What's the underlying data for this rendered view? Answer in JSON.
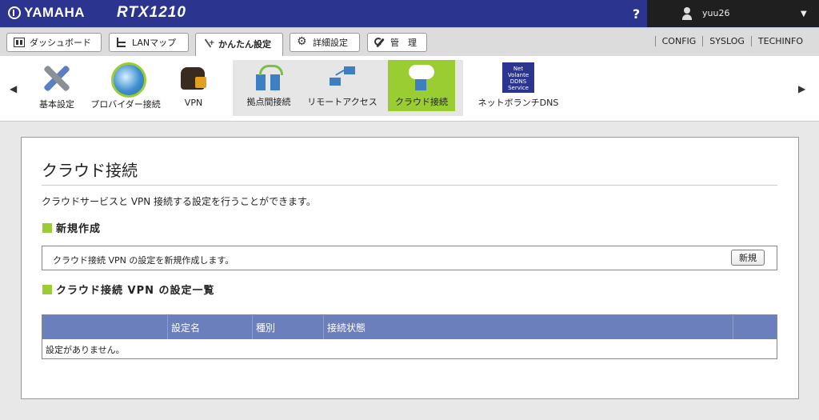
{
  "header": {
    "brand": "YAMAHA",
    "model": "RTX1210",
    "help": "?",
    "username": "yuu26"
  },
  "menubar": {
    "tabs": [
      {
        "label": "ダッシュボード",
        "icon": "dashboard-icon"
      },
      {
        "label": "LANマップ",
        "icon": "lan-map-icon"
      },
      {
        "label": "かんたん設定",
        "icon": "wizard-icon",
        "active": true
      },
      {
        "label": "詳細設定",
        "icon": "gear-icon"
      },
      {
        "label": "管　理",
        "icon": "wrench-icon"
      }
    ],
    "links": [
      "CONFIG",
      "SYSLOG",
      "TECHINFO"
    ]
  },
  "iconstrip": {
    "items": [
      {
        "label": "基本設定",
        "icon": "tools-icon"
      },
      {
        "label": "プロバイダー接続",
        "icon": "globe-icon"
      },
      {
        "label": "VPN",
        "icon": "vpn-icon"
      }
    ],
    "subitems": [
      {
        "label": "拠点間接続",
        "icon": "site-to-site-icon"
      },
      {
        "label": "リモートアクセス",
        "icon": "remote-access-icon"
      },
      {
        "label": "クラウド接続",
        "icon": "cloud-icon",
        "active": true
      }
    ],
    "ddns": {
      "label": "ネットボランチDNS",
      "badge_line1": "Net Volante",
      "badge_line2": "DDNS",
      "badge_line3": "Service"
    }
  },
  "main": {
    "title": "クラウド接続",
    "description": "クラウドサービスと VPN 接続する設定を行うことができます。",
    "new_section": {
      "heading": "新規作成",
      "text": "クラウド接続 VPN の設定を新規作成します。",
      "button": "新規"
    },
    "list_section": {
      "heading": "クラウド接続 VPN の設定一覧",
      "columns": [
        "",
        "設定名",
        "種別",
        "接続状態",
        ""
      ],
      "empty_message": "設定がありません。"
    }
  },
  "colors": {
    "header_bg": "#2b3590",
    "accent_green": "#9acd32",
    "table_header": "#6b7fbd"
  }
}
